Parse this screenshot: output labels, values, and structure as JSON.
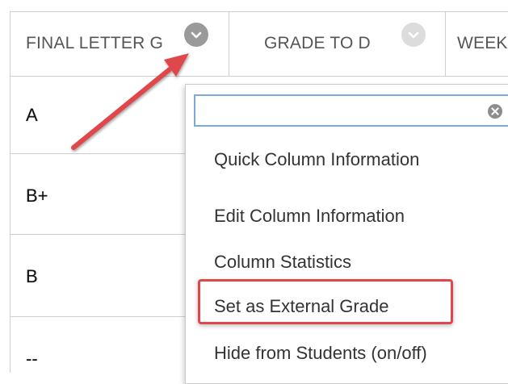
{
  "columns": [
    {
      "label": "FINAL LETTER G"
    },
    {
      "label": "GRADE TO D"
    },
    {
      "label": "WEEK"
    }
  ],
  "rows": [
    {
      "grade": "A"
    },
    {
      "grade": "B+"
    },
    {
      "grade": "B"
    },
    {
      "grade": "--"
    }
  ],
  "menu": {
    "search_value": "",
    "items": [
      {
        "label": "Quick Column Information"
      },
      {
        "label": "Edit Column Information"
      },
      {
        "label": "Column Statistics"
      },
      {
        "label": "Set as External Grade"
      },
      {
        "label": "Hide from Students (on/off)"
      }
    ]
  },
  "colors": {
    "chevron_active": "#9a9a9a",
    "chevron_inactive": "#dcdcdc",
    "annotation_red": "#e0474c",
    "search_border": "#7aa9dc"
  },
  "icons": {
    "column_menu": "chevron-down-circle-icon",
    "search_clear": "close-circle-icon",
    "annotation": "arrow-annotation"
  }
}
